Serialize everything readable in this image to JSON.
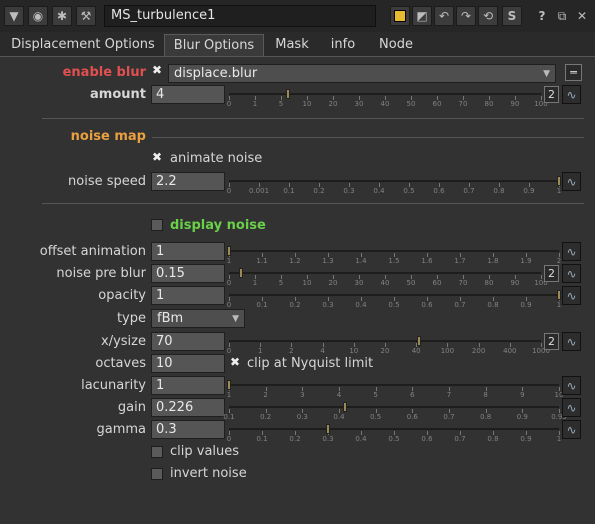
{
  "titlebar": {
    "node_name": "MS_turbulence1",
    "help_label": "?",
    "script_label": "S"
  },
  "tabs": [
    {
      "label": "Displacement Options"
    },
    {
      "label": "Blur Options"
    },
    {
      "label": "Mask"
    },
    {
      "label": "info"
    },
    {
      "label": "Node"
    }
  ],
  "enable_blur": {
    "label": "enable blur",
    "value": "displace.blur",
    "checked": true,
    "color": "#e05050"
  },
  "amount": {
    "label": "amount",
    "value": "4",
    "dim_label": "2",
    "ticks": [
      "0",
      "1",
      "5",
      "10",
      "20",
      "30",
      "40",
      "50",
      "60",
      "70",
      "80",
      "90",
      "100"
    ]
  },
  "noise_map": {
    "heading": "noise map",
    "color": "#e8a040"
  },
  "animate_noise": {
    "label": "animate noise",
    "checked": true
  },
  "noise_speed": {
    "label": "noise speed",
    "value": "2.2",
    "ticks": [
      "0",
      "0.001",
      "0.1",
      "0.2",
      "0.3",
      "0.4",
      "0.5",
      "0.6",
      "0.7",
      "0.8",
      "0.9",
      "1"
    ]
  },
  "display_noise": {
    "label": "display noise",
    "checked": false,
    "color": "#6ad04a"
  },
  "offset_animation": {
    "label": "offset animation",
    "value": "1",
    "ticks": [
      "1",
      "1.1",
      "1.2",
      "1.3",
      "1.4",
      "1.5",
      "1.6",
      "1.7",
      "1.8",
      "1.9",
      "2"
    ]
  },
  "noise_pre_blur": {
    "label": "noise pre blur",
    "value": "0.15",
    "dim_label": "2",
    "ticks": [
      "0",
      "1",
      "5",
      "10",
      "20",
      "30",
      "40",
      "50",
      "60",
      "70",
      "80",
      "90",
      "100"
    ]
  },
  "opacity": {
    "label": "opacity",
    "value": "1",
    "ticks": [
      "0",
      "0.1",
      "0.2",
      "0.3",
      "0.4",
      "0.5",
      "0.6",
      "0.7",
      "0.8",
      "0.9",
      "1"
    ]
  },
  "type": {
    "label": "type",
    "value": "fBm"
  },
  "xysize": {
    "label": "x/ysize",
    "value": "70",
    "dim_label": "2",
    "ticks": [
      "0",
      "1",
      "2",
      "4",
      "10",
      "20",
      "40",
      "100",
      "200",
      "400",
      "1000"
    ]
  },
  "octaves": {
    "label": "octaves",
    "value": "10"
  },
  "clip_nyquist": {
    "label": "clip at Nyquist limit",
    "checked": true
  },
  "lacunarity": {
    "label": "lacunarity",
    "value": "1",
    "ticks": [
      "1",
      "2",
      "3",
      "4",
      "5",
      "6",
      "7",
      "8",
      "9",
      "10"
    ]
  },
  "gain": {
    "label": "gain",
    "value": "0.226",
    "ticks": [
      "0.1",
      "0.2",
      "0.3",
      "0.4",
      "0.5",
      "0.6",
      "0.7",
      "0.8",
      "0.9",
      "0.95"
    ]
  },
  "gamma": {
    "label": "gamma",
    "value": "0.3",
    "ticks": [
      "0",
      "0.1",
      "0.2",
      "0.3",
      "0.4",
      "0.5",
      "0.6",
      "0.7",
      "0.8",
      "0.9",
      "1"
    ]
  },
  "clip_values": {
    "label": "clip values",
    "checked": false
  },
  "invert_noise": {
    "label": "invert noise",
    "checked": false
  },
  "colors": {
    "background": "#323232",
    "field": "#555555",
    "accent_button": "#e8b830"
  }
}
